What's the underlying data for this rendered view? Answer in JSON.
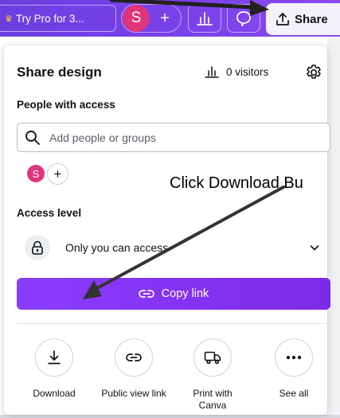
{
  "topbar": {
    "promo_label": "Try Pro for 3...",
    "avatar_initial": "S",
    "add_collaborator_symbol": "+",
    "share_label": "Share",
    "icons": [
      "crown-icon",
      "plus-icon",
      "analytics-icon",
      "comment-icon",
      "upload-icon"
    ]
  },
  "panel": {
    "title": "Share design",
    "visitors_label": "0 visitors",
    "people_heading": "People with access",
    "search_placeholder": "Add people or groups",
    "member_initial": "S",
    "add_member_symbol": "+",
    "access_heading": "Access level",
    "access_value": "Only you can access",
    "copy_link_label": "Copy link",
    "actions": [
      {
        "label": "Download",
        "icon": "download-icon"
      },
      {
        "label": "Public view link",
        "icon": "link-icon"
      },
      {
        "label": "Print with Canva",
        "icon": "truck-icon"
      },
      {
        "label": "See all",
        "icon": "more-icon"
      }
    ]
  },
  "annotation": {
    "text": "Click Download Bu"
  },
  "colors": {
    "topbar": "#7a41ea",
    "avatar": "#e0347d",
    "copy_button": "#8b3dff",
    "share_button_bg": "#f4f2fb"
  }
}
